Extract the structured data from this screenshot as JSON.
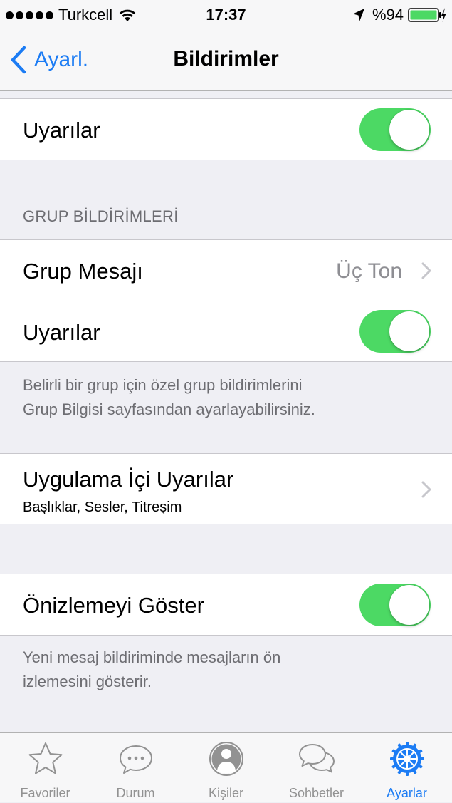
{
  "status_bar": {
    "carrier": "Turkcell",
    "time": "17:37",
    "battery": "%94"
  },
  "nav": {
    "back_label": "Ayarl.",
    "title": "Bildirimler"
  },
  "alerts_row": {
    "label": "Uyarılar",
    "enabled": true
  },
  "group_section": {
    "header": "GRUP BİLDİRİMLERİ",
    "group_message_label": "Grup Mesajı",
    "group_message_value": "Üç Ton",
    "alerts_label": "Uyarılar",
    "alerts_enabled": true,
    "footer_line1": "Belirli bir grup için özel grup bildirimlerini",
    "footer_line2": "Grup Bilgisi sayfasından ayarlayabilirsiniz."
  },
  "in_app": {
    "label": "Uygulama İçi Uyarılar",
    "subtitle": "Başlıklar, Sesler, Titreşim"
  },
  "preview": {
    "label": "Önizlemeyi Göster",
    "enabled": true,
    "footer_line1": "Yeni mesaj bildiriminde mesajların ön",
    "footer_line2": "izlemesini gösterir."
  },
  "tabs": [
    {
      "label": "Favoriler",
      "icon": "star-icon"
    },
    {
      "label": "Durum",
      "icon": "speech-bubble-icon"
    },
    {
      "label": "Kişiler",
      "icon": "person-icon"
    },
    {
      "label": "Sohbetler",
      "icon": "chat-bubbles-icon"
    },
    {
      "label": "Ayarlar",
      "icon": "gear-icon",
      "active": true
    }
  ],
  "colors": {
    "accent": "#1c7cf4",
    "toggle_on": "#4cd964",
    "background": "#efeff4",
    "secondary_text": "#6d6d72"
  }
}
